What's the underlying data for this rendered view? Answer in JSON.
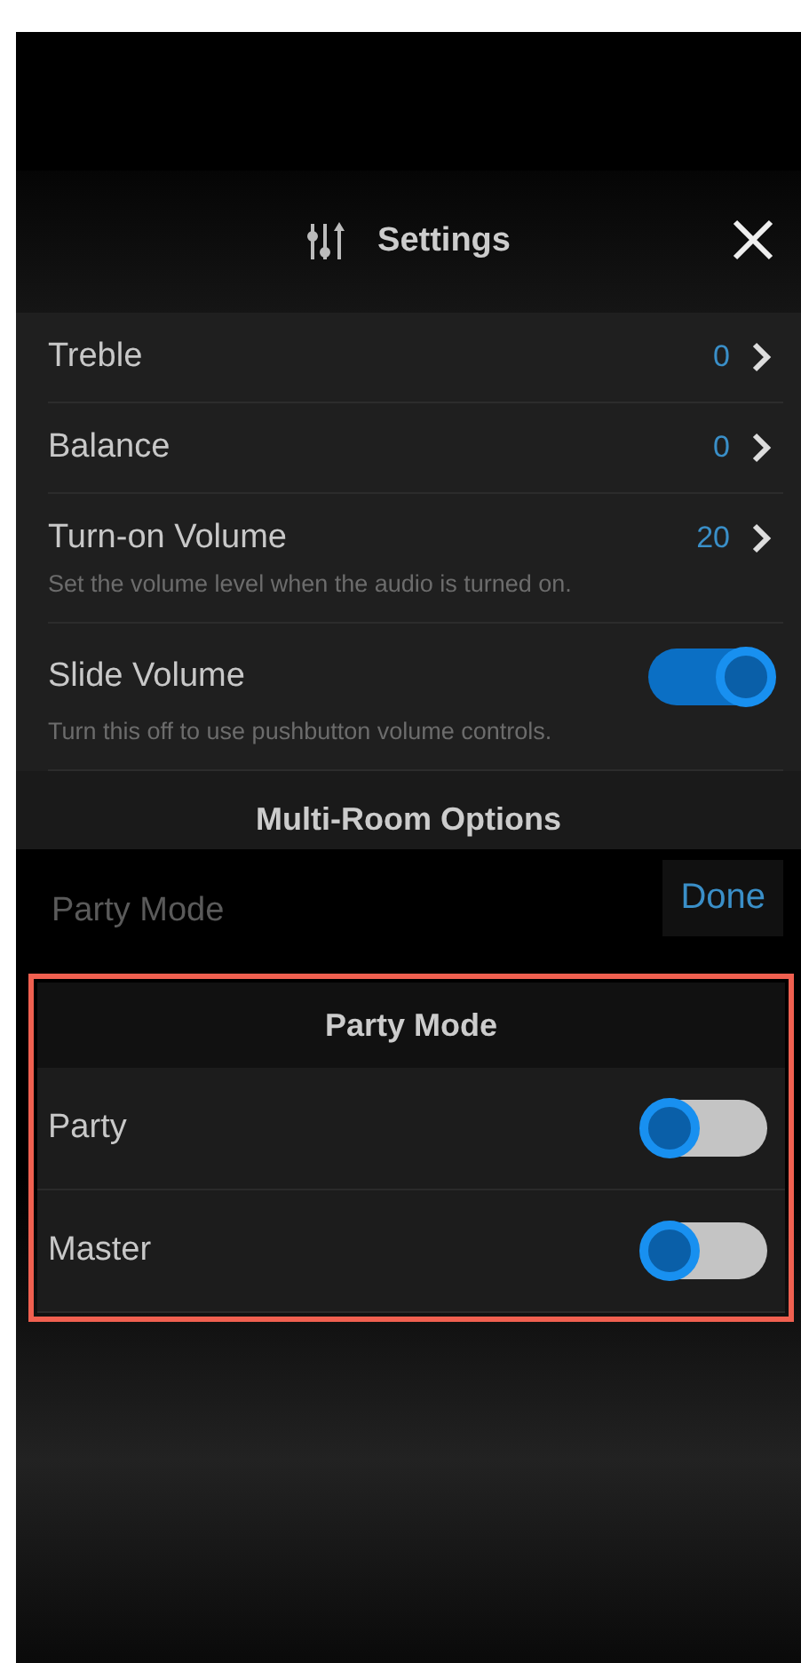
{
  "header": {
    "title": "Settings"
  },
  "settings": [
    {
      "kind": "value",
      "label": "Treble",
      "value": "0"
    },
    {
      "kind": "value",
      "label": "Balance",
      "value": "0"
    },
    {
      "kind": "value",
      "label": "Turn-on Volume",
      "value": "20",
      "description": "Set the volume level when the audio is turned on."
    },
    {
      "kind": "toggle",
      "label": "Slide Volume",
      "on": true,
      "description": "Turn this off to use pushbutton volume controls."
    }
  ],
  "section_title": "Multi-Room Options",
  "dimmed_row": {
    "label": "Party Mode"
  },
  "done_button": "Done",
  "sheet": {
    "title": "Party Mode",
    "highlighted": true,
    "rows": [
      {
        "label": "Party",
        "on": false
      },
      {
        "label": "Master",
        "on": false
      }
    ]
  }
}
